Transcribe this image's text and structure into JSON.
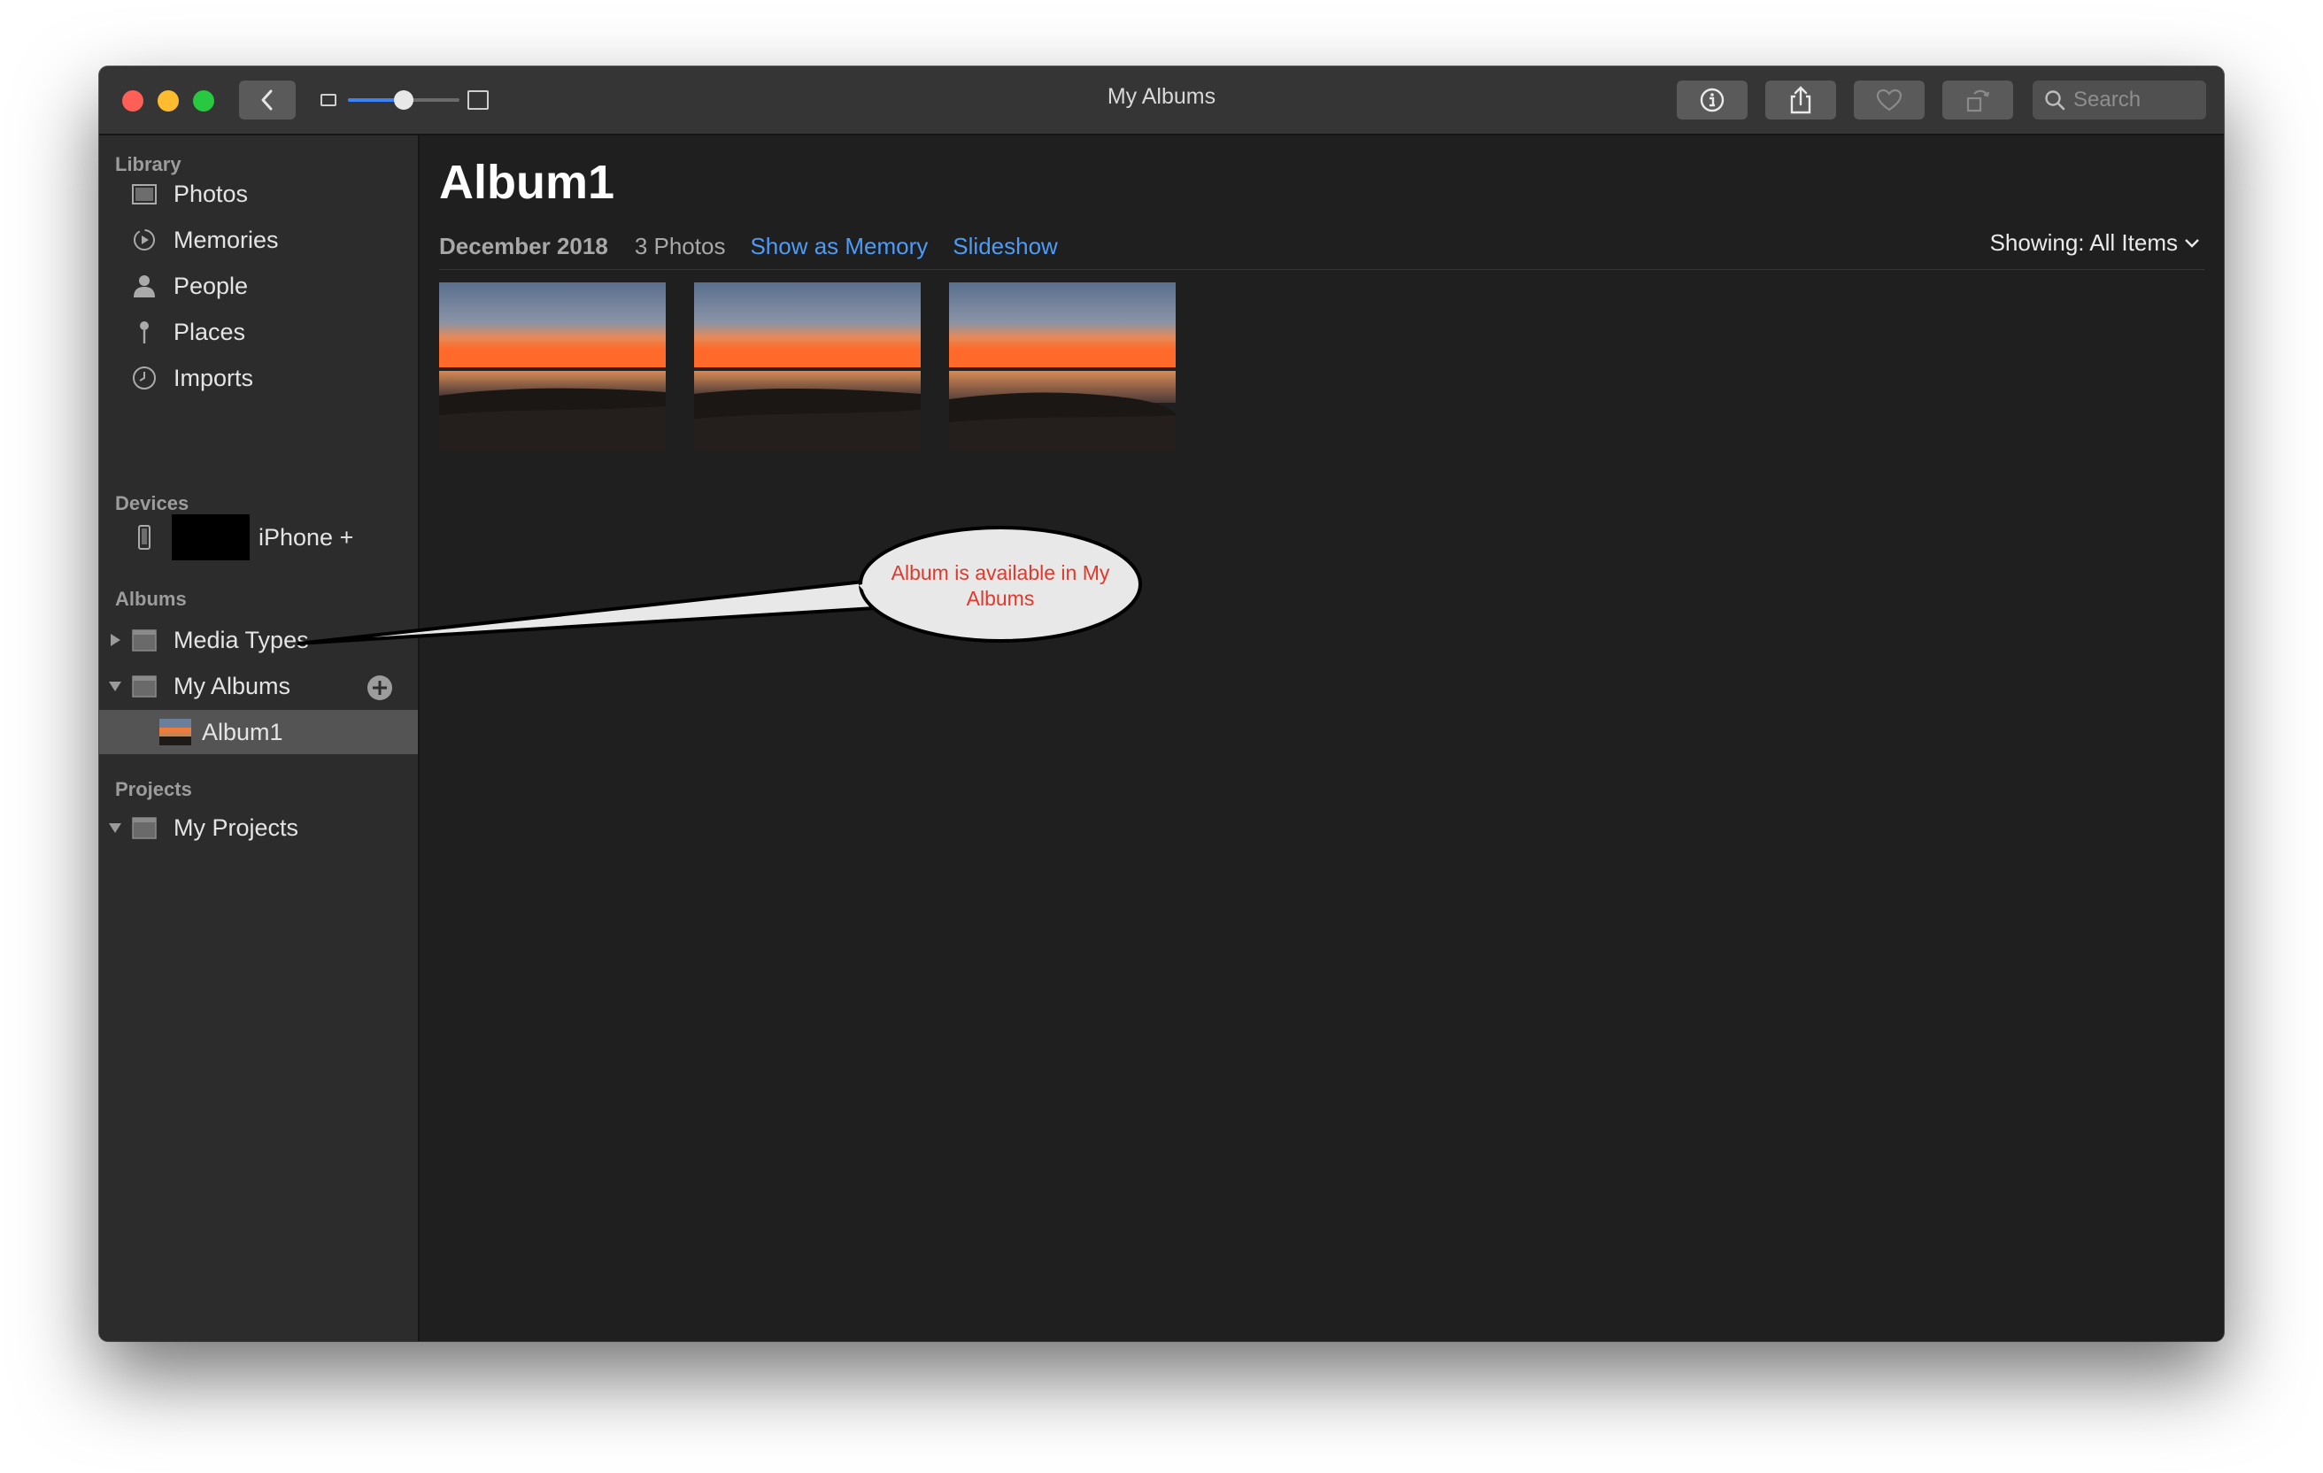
{
  "window": {
    "title": "My Albums"
  },
  "toolbar": {
    "back_icon": "chevron-left-icon",
    "info_icon": "info-icon",
    "share_icon": "share-icon",
    "favorite_icon": "heart-icon",
    "rotate_icon": "rotate-icon",
    "zoom_level": 0.5,
    "search": {
      "placeholder": "Search",
      "value": ""
    }
  },
  "sidebar": {
    "library": {
      "heading": "Library",
      "items": [
        {
          "label": "Photos",
          "icon": "photos-icon"
        },
        {
          "label": "Memories",
          "icon": "memories-icon"
        },
        {
          "label": "People",
          "icon": "people-icon"
        },
        {
          "label": "Places",
          "icon": "places-icon"
        },
        {
          "label": "Imports",
          "icon": "imports-icon"
        }
      ]
    },
    "devices": {
      "heading": "Devices",
      "items": [
        {
          "label": "iPhone +",
          "icon": "iphone-icon"
        }
      ]
    },
    "albums": {
      "heading": "Albums",
      "items": [
        {
          "label": "Media Types",
          "icon": "folder-icon",
          "expanded": false
        },
        {
          "label": "My Albums",
          "icon": "folder-icon",
          "expanded": true
        },
        {
          "label": "Album1",
          "icon": "album-thumbnail-icon",
          "selected": true
        }
      ]
    },
    "projects": {
      "heading": "Projects",
      "items": [
        {
          "label": "My Projects",
          "icon": "folder-icon",
          "expanded": true
        }
      ]
    }
  },
  "main": {
    "title": "Album1",
    "date": "December 2018",
    "count": "3 Photos",
    "links": {
      "memory": "Show as Memory",
      "slideshow": "Slideshow"
    },
    "showing": "Showing: All Items",
    "photos": [
      {
        "subject": "sunset-over-water"
      },
      {
        "subject": "sunset-over-water"
      },
      {
        "subject": "sunset-over-water"
      }
    ]
  },
  "annotation": {
    "line1": "Album is available in My",
    "line2": "Albums",
    "text_color": "#e0392b"
  },
  "colors": {
    "accent": "#4e9bf6",
    "selection": "#545454"
  }
}
